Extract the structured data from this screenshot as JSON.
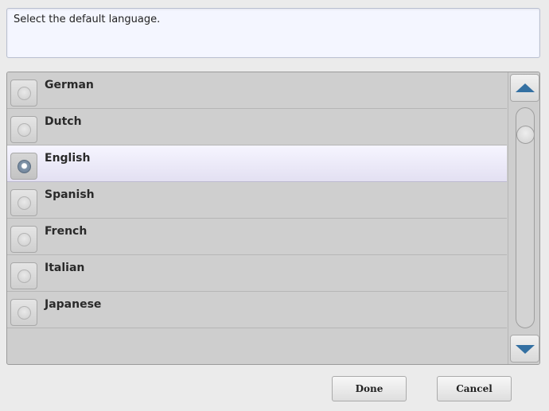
{
  "instruction": {
    "text": "Select the default language."
  },
  "languages": [
    {
      "label": "German",
      "selected": false
    },
    {
      "label": "Dutch",
      "selected": false
    },
    {
      "label": "English",
      "selected": true
    },
    {
      "label": "Spanish",
      "selected": false
    },
    {
      "label": "French",
      "selected": false
    },
    {
      "label": "Italian",
      "selected": false
    },
    {
      "label": "Japanese",
      "selected": false
    }
  ],
  "scrollbar": {
    "up_icon": "arrow-up-icon",
    "down_icon": "arrow-down-icon"
  },
  "buttons": {
    "done_label": "Done",
    "cancel_label": "Cancel"
  },
  "colors": {
    "accent_arrow": "#3470a2",
    "selected_row": "#eceaf8"
  }
}
